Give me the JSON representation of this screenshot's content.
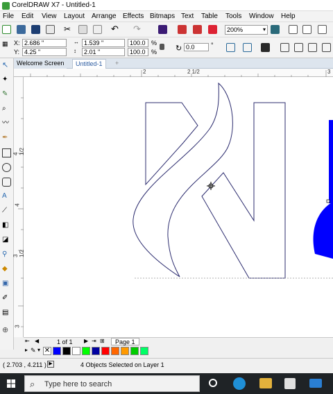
{
  "window": {
    "title": "CorelDRAW X7 - Untitled-1"
  },
  "menu": [
    "File",
    "Edit",
    "View",
    "Layout",
    "Arrange",
    "Effects",
    "Bitmaps",
    "Text",
    "Table",
    "Tools",
    "Window",
    "Help"
  ],
  "toolbar": {
    "zoom": "200%"
  },
  "properties": {
    "x_label": "X:",
    "x_value": "2.686 \"",
    "y_label": "Y:",
    "y_value": "4.25 \"",
    "w_value": "1.539 \"",
    "h_value": "2.01 \"",
    "scale_w": "100.0",
    "scale_h": "100.0",
    "pct": "%",
    "rotation": "0.0",
    "degree": "°"
  },
  "tabs": [
    "Welcome Screen",
    "Untitled-1"
  ],
  "ruler": {
    "top": [
      "2",
      "2 1/2",
      "3"
    ],
    "left": [
      "4 1/2",
      "4",
      "3 1/2",
      "3"
    ]
  },
  "doc_nav": {
    "page_count": "1 of 1",
    "page_tab": "Page 1"
  },
  "palette": [
    "#0000ff",
    "#000000",
    "#ffffff",
    "#00ff00",
    "#0000a0",
    "#ff0000",
    "#ff6600",
    "#ff9900",
    "#00cc00",
    "#00ff66"
  ],
  "status": {
    "coords": "( 2.703 , 4.211 )",
    "message": "4 Objects Selected on Layer 1"
  },
  "taskbar": {
    "search_placeholder": "Type here to search"
  },
  "colors": {
    "outline": "#2b2b6e",
    "fill_blue": "#0000ff"
  }
}
